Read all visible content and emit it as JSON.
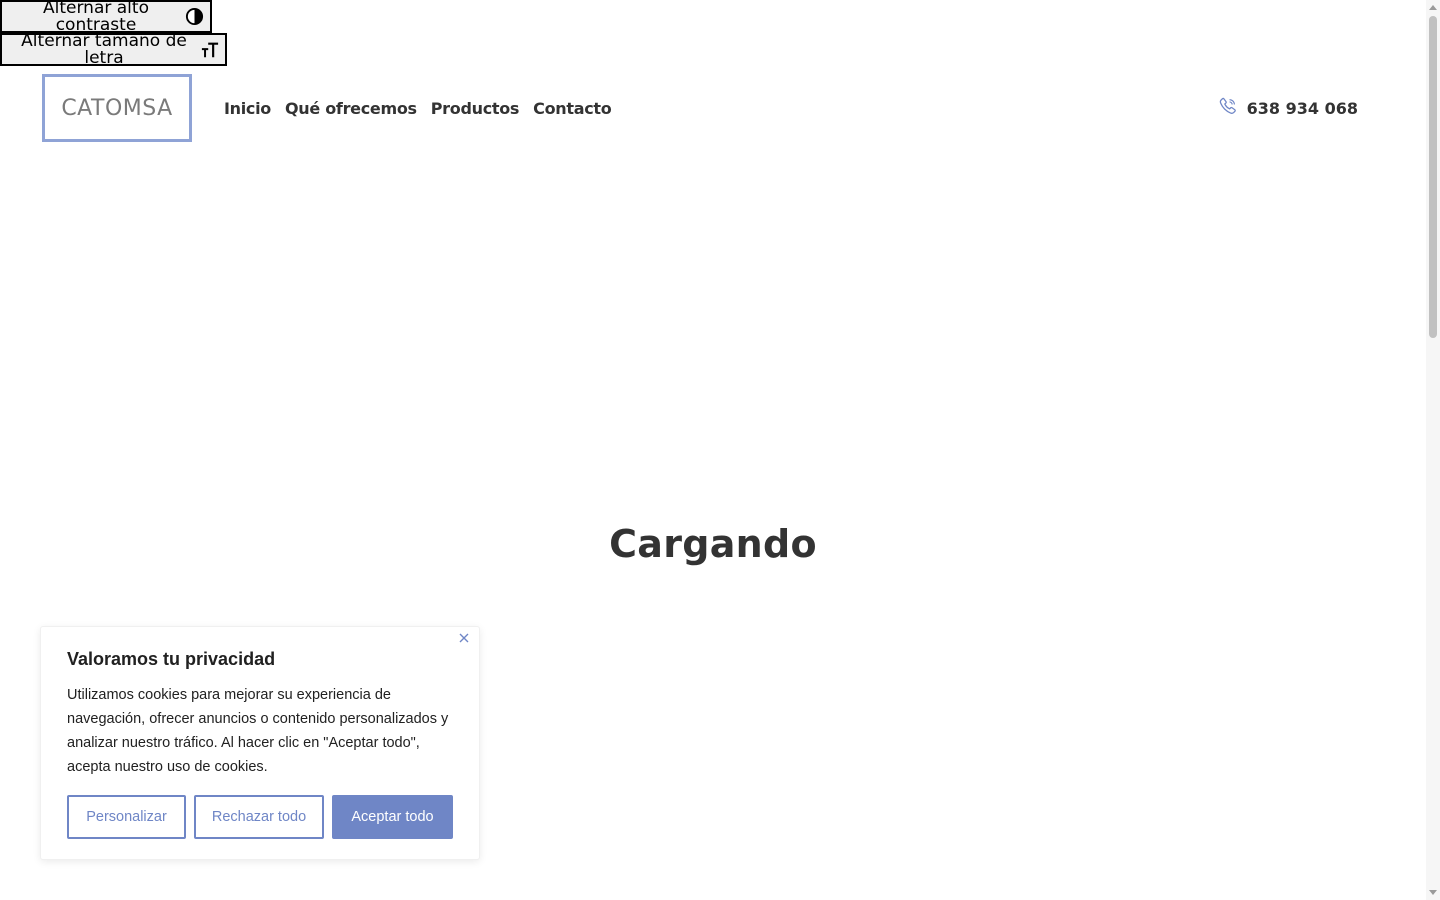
{
  "accessibility": {
    "contrast_label": "Alternar alto contraste",
    "font_size_label": "Alternar tamaño de letra"
  },
  "header": {
    "logo": "CATOMSA",
    "nav": [
      "Inicio",
      "Qué ofrecemos",
      "Productos",
      "Contacto"
    ],
    "phone": "638 934 068",
    "accent_color": "#6f86c6"
  },
  "main": {
    "loading_text": "Cargando"
  },
  "cookie_banner": {
    "title": "Valoramos tu privacidad",
    "text": "Utilizamos cookies para mejorar su experiencia de navegación, ofrecer anuncios o contenido personalizados y analizar nuestro tráfico. Al hacer clic en \"Aceptar todo\", acepta nuestro uso de cookies.",
    "customize_label": "Personalizar",
    "reject_label": "Rechazar todo",
    "accept_label": "Aceptar todo"
  },
  "icons": {
    "contrast": "contrast-icon",
    "font_size": "font-size-icon",
    "phone": "phone-icon",
    "close": "close-icon"
  }
}
